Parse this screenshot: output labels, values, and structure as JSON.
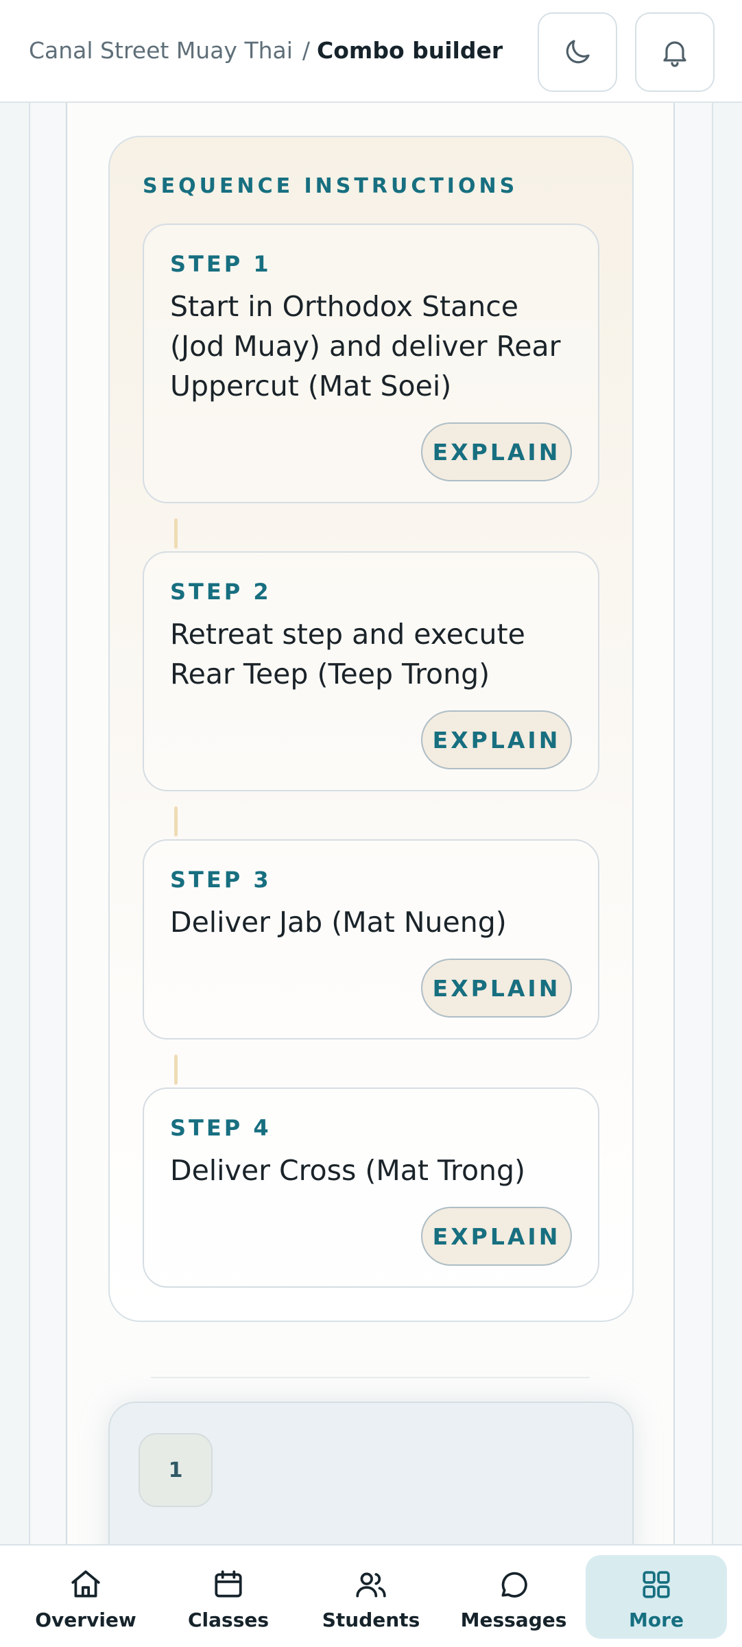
{
  "header": {
    "org_name": "Canal Street Muay Thai",
    "separator": "/",
    "page_title": "Combo builder",
    "theme_toggle_icon": "moon-icon",
    "notifications_icon": "bell-icon"
  },
  "sequence": {
    "title": "SEQUENCE INSTRUCTIONS",
    "steps": [
      {
        "label": "STEP 1",
        "text": "Start in Orthodox Stance (Jod Muay) and deliver Rear Uppercut (Mat Soei)",
        "button": "EXPLAIN"
      },
      {
        "label": "STEP 2",
        "text": "Retreat step and execute Rear Teep (Teep Trong)",
        "button": "EXPLAIN"
      },
      {
        "label": "STEP 3",
        "text": "Deliver Jab (Mat Nueng)",
        "button": "EXPLAIN"
      },
      {
        "label": "STEP 4",
        "text": "Deliver Cross (Mat Trong)",
        "button": "EXPLAIN"
      }
    ]
  },
  "next_section": {
    "number": "1"
  },
  "nav": {
    "items": [
      {
        "label": "Overview",
        "icon": "home-icon",
        "active": false
      },
      {
        "label": "Classes",
        "icon": "calendar-icon",
        "active": false
      },
      {
        "label": "Students",
        "icon": "users-icon",
        "active": false
      },
      {
        "label": "Messages",
        "icon": "message-icon",
        "active": false
      },
      {
        "label": "More",
        "icon": "grid-icon",
        "active": true
      }
    ]
  },
  "colors": {
    "accent": "#176f80",
    "active_nav_bg": "#d8ecf0",
    "connector": "#eedcb5"
  }
}
